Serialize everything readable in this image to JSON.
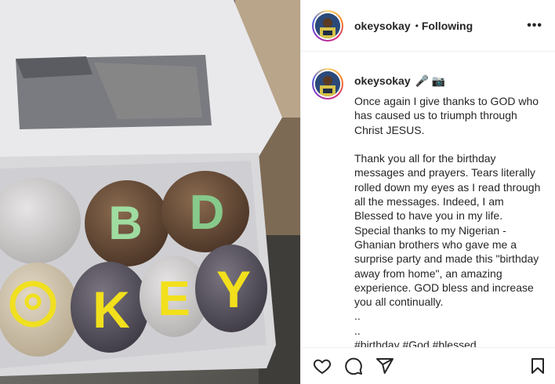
{
  "post": {
    "username": "okeysokay",
    "separator": "•",
    "follow_status": "Following",
    "more_label": "•••",
    "caption": {
      "username": "okeysokay",
      "emoji": "🎤 📷",
      "text": "Once again I give thanks to GOD who has caused us to triumph through Christ JESUS.\n\nThank you all for the birthday messages and prayers. Tears literally rolled down my eyes as I read through all the messages. Indeed, I am Blessed to have you in my life.\nSpecial thanks to my Nigerian - Ghanian brothers who gave me a surprise party and made this \"birthday away from home\", an amazing experience. GOD bless and increase you all continually.\n..\n..\n#birthday #God #blessed"
    },
    "photo": {
      "cookie_letters": [
        "B",
        "D",
        "O",
        "K",
        "E",
        "Y"
      ]
    },
    "actions": {
      "like": "heart-icon",
      "comment": "comment-icon",
      "share": "paper-plane-icon",
      "save": "bookmark-icon"
    }
  }
}
